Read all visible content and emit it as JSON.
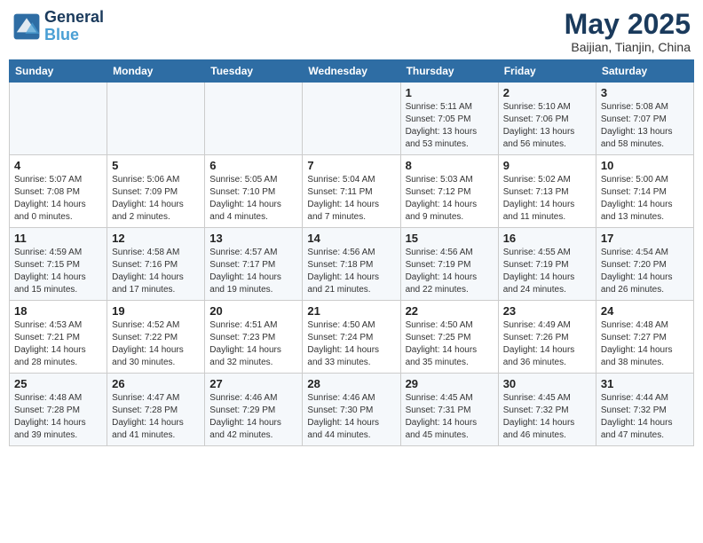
{
  "header": {
    "logo_line1": "General",
    "logo_line2": "Blue",
    "month": "May 2025",
    "location": "Baijian, Tianjin, China"
  },
  "weekdays": [
    "Sunday",
    "Monday",
    "Tuesday",
    "Wednesday",
    "Thursday",
    "Friday",
    "Saturday"
  ],
  "weeks": [
    [
      {
        "day": "",
        "info": ""
      },
      {
        "day": "",
        "info": ""
      },
      {
        "day": "",
        "info": ""
      },
      {
        "day": "",
        "info": ""
      },
      {
        "day": "1",
        "info": "Sunrise: 5:11 AM\nSunset: 7:05 PM\nDaylight: 13 hours\nand 53 minutes."
      },
      {
        "day": "2",
        "info": "Sunrise: 5:10 AM\nSunset: 7:06 PM\nDaylight: 13 hours\nand 56 minutes."
      },
      {
        "day": "3",
        "info": "Sunrise: 5:08 AM\nSunset: 7:07 PM\nDaylight: 13 hours\nand 58 minutes."
      }
    ],
    [
      {
        "day": "4",
        "info": "Sunrise: 5:07 AM\nSunset: 7:08 PM\nDaylight: 14 hours\nand 0 minutes."
      },
      {
        "day": "5",
        "info": "Sunrise: 5:06 AM\nSunset: 7:09 PM\nDaylight: 14 hours\nand 2 minutes."
      },
      {
        "day": "6",
        "info": "Sunrise: 5:05 AM\nSunset: 7:10 PM\nDaylight: 14 hours\nand 4 minutes."
      },
      {
        "day": "7",
        "info": "Sunrise: 5:04 AM\nSunset: 7:11 PM\nDaylight: 14 hours\nand 7 minutes."
      },
      {
        "day": "8",
        "info": "Sunrise: 5:03 AM\nSunset: 7:12 PM\nDaylight: 14 hours\nand 9 minutes."
      },
      {
        "day": "9",
        "info": "Sunrise: 5:02 AM\nSunset: 7:13 PM\nDaylight: 14 hours\nand 11 minutes."
      },
      {
        "day": "10",
        "info": "Sunrise: 5:00 AM\nSunset: 7:14 PM\nDaylight: 14 hours\nand 13 minutes."
      }
    ],
    [
      {
        "day": "11",
        "info": "Sunrise: 4:59 AM\nSunset: 7:15 PM\nDaylight: 14 hours\nand 15 minutes."
      },
      {
        "day": "12",
        "info": "Sunrise: 4:58 AM\nSunset: 7:16 PM\nDaylight: 14 hours\nand 17 minutes."
      },
      {
        "day": "13",
        "info": "Sunrise: 4:57 AM\nSunset: 7:17 PM\nDaylight: 14 hours\nand 19 minutes."
      },
      {
        "day": "14",
        "info": "Sunrise: 4:56 AM\nSunset: 7:18 PM\nDaylight: 14 hours\nand 21 minutes."
      },
      {
        "day": "15",
        "info": "Sunrise: 4:56 AM\nSunset: 7:19 PM\nDaylight: 14 hours\nand 22 minutes."
      },
      {
        "day": "16",
        "info": "Sunrise: 4:55 AM\nSunset: 7:19 PM\nDaylight: 14 hours\nand 24 minutes."
      },
      {
        "day": "17",
        "info": "Sunrise: 4:54 AM\nSunset: 7:20 PM\nDaylight: 14 hours\nand 26 minutes."
      }
    ],
    [
      {
        "day": "18",
        "info": "Sunrise: 4:53 AM\nSunset: 7:21 PM\nDaylight: 14 hours\nand 28 minutes."
      },
      {
        "day": "19",
        "info": "Sunrise: 4:52 AM\nSunset: 7:22 PM\nDaylight: 14 hours\nand 30 minutes."
      },
      {
        "day": "20",
        "info": "Sunrise: 4:51 AM\nSunset: 7:23 PM\nDaylight: 14 hours\nand 32 minutes."
      },
      {
        "day": "21",
        "info": "Sunrise: 4:50 AM\nSunset: 7:24 PM\nDaylight: 14 hours\nand 33 minutes."
      },
      {
        "day": "22",
        "info": "Sunrise: 4:50 AM\nSunset: 7:25 PM\nDaylight: 14 hours\nand 35 minutes."
      },
      {
        "day": "23",
        "info": "Sunrise: 4:49 AM\nSunset: 7:26 PM\nDaylight: 14 hours\nand 36 minutes."
      },
      {
        "day": "24",
        "info": "Sunrise: 4:48 AM\nSunset: 7:27 PM\nDaylight: 14 hours\nand 38 minutes."
      }
    ],
    [
      {
        "day": "25",
        "info": "Sunrise: 4:48 AM\nSunset: 7:28 PM\nDaylight: 14 hours\nand 39 minutes."
      },
      {
        "day": "26",
        "info": "Sunrise: 4:47 AM\nSunset: 7:28 PM\nDaylight: 14 hours\nand 41 minutes."
      },
      {
        "day": "27",
        "info": "Sunrise: 4:46 AM\nSunset: 7:29 PM\nDaylight: 14 hours\nand 42 minutes."
      },
      {
        "day": "28",
        "info": "Sunrise: 4:46 AM\nSunset: 7:30 PM\nDaylight: 14 hours\nand 44 minutes."
      },
      {
        "day": "29",
        "info": "Sunrise: 4:45 AM\nSunset: 7:31 PM\nDaylight: 14 hours\nand 45 minutes."
      },
      {
        "day": "30",
        "info": "Sunrise: 4:45 AM\nSunset: 7:32 PM\nDaylight: 14 hours\nand 46 minutes."
      },
      {
        "day": "31",
        "info": "Sunrise: 4:44 AM\nSunset: 7:32 PM\nDaylight: 14 hours\nand 47 minutes."
      }
    ]
  ]
}
